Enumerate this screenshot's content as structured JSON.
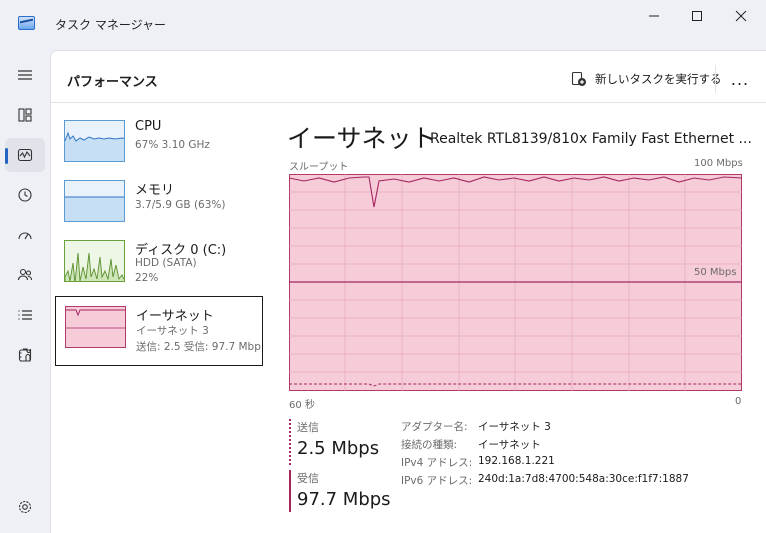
{
  "window": {
    "title": "タスク マネージャー"
  },
  "nav": [
    {
      "icon": "hamburger-menu-icon"
    },
    {
      "icon": "processes-icon"
    },
    {
      "icon": "performance-icon",
      "active": true
    },
    {
      "icon": "app-history-icon"
    },
    {
      "icon": "startup-apps-icon"
    },
    {
      "icon": "users-icon"
    },
    {
      "icon": "details-icon"
    },
    {
      "icon": "services-icon"
    },
    {
      "icon": "settings-icon"
    }
  ],
  "header": {
    "title": "パフォーマンス",
    "run_task_label": "新しいタスクを実行する",
    "more_label": "..."
  },
  "devices": [
    {
      "name": "CPU",
      "sub1": "67%  3.10 GHz",
      "sub2": ""
    },
    {
      "name": "メモリ",
      "sub1": "3.7/5.9 GB (63%)",
      "sub2": ""
    },
    {
      "name": "ディスク 0 (C:)",
      "sub1": "HDD (SATA)",
      "sub2": "22%"
    },
    {
      "name": "イーサネット",
      "sub1": "イーサネット 3",
      "sub2": "送信: 2.5  受信: 97.7 Mbp"
    }
  ],
  "detail": {
    "title": "イーサネット",
    "adapter": "Realtek RTL8139/810x Family Fast Ethernet ...",
    "graph_top_left": "スループット",
    "graph_top_right": "100 Mbps",
    "graph_mid_right": "50 Mbps",
    "graph_bottom_left": "60 秒",
    "graph_bottom_right": "0"
  },
  "stats": {
    "send_label": "送信",
    "send_value": "2.5 Mbps",
    "recv_label": "受信",
    "recv_value": "97.7 Mbps"
  },
  "properties": [
    {
      "key": "アダプター名:",
      "value": "イーサネット 3"
    },
    {
      "key": "接続の種類:",
      "value": "イーサネット"
    },
    {
      "key": "IPv4 アドレス:",
      "value": "192.168.1.221"
    },
    {
      "key": "IPv6 アドレス:",
      "value": "240d:1a:7d8:4700:548a:30ce:f1f7:1887"
    }
  ],
  "colors": {
    "network_fill": "#f6ccd9",
    "network_line": "#a52660",
    "window_bg": "#eef0f5",
    "accent": "#2564c4"
  }
}
